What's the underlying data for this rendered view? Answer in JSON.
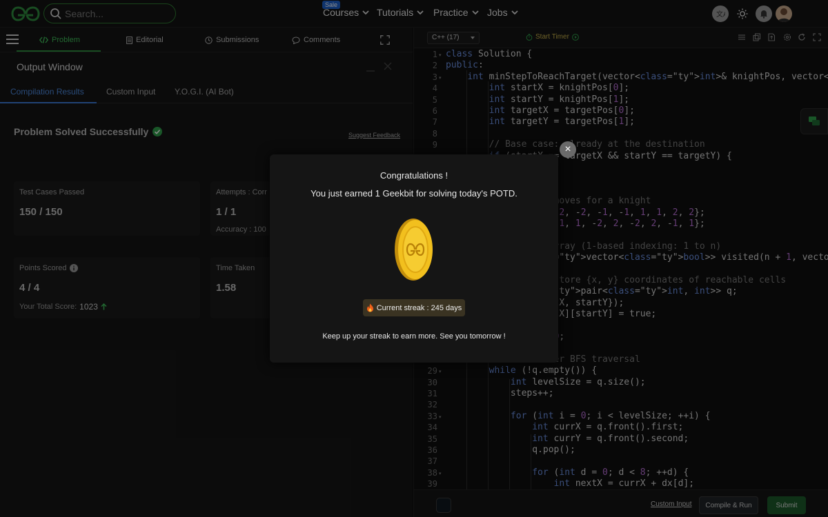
{
  "nav": {
    "search_placeholder": "Search...",
    "sale_badge": "Sale",
    "items": [
      {
        "label": "Courses"
      },
      {
        "label": "Tutorials"
      },
      {
        "label": "Practice"
      },
      {
        "label": "Jobs"
      }
    ]
  },
  "problem_tabs": [
    {
      "label": "Problem"
    },
    {
      "label": "Editorial"
    },
    {
      "label": "Submissions"
    },
    {
      "label": "Comments"
    }
  ],
  "output": {
    "title": "Output Window",
    "tabs": [
      {
        "label": "Compilation Results"
      },
      {
        "label": "Custom Input"
      },
      {
        "label": "Y.O.G.I. (AI Bot)"
      }
    ],
    "status": "Problem Solved Successfully",
    "feedback": "Suggest Feedback",
    "cards": {
      "test_cases": {
        "label": "Test Cases Passed",
        "value": "150 / 150"
      },
      "attempts": {
        "label": "Attempts : Corr",
        "value": "1 / 1",
        "sub": "Accuracy : 100"
      },
      "points": {
        "label": "Points Scored",
        "value": "4 / 4",
        "sub_label": "Your Total Score:",
        "sub_value": "1023"
      },
      "time": {
        "label": "Time Taken",
        "value": "1.58"
      }
    }
  },
  "editor": {
    "language": "C++ (17)",
    "timer": "Start Timer",
    "custom_input": "Custom Input",
    "compile": "Compile & Run",
    "submit": "Submit",
    "lines": [
      {
        "n": "1",
        "fold": true,
        "code": "class Solution {"
      },
      {
        "n": "2",
        "code": "public:"
      },
      {
        "n": "3",
        "fold": true,
        "code": "    int minStepToReachTarget(vector<int>& knightPos, vector<int>& targe"
      },
      {
        "n": "4",
        "code": "        int startX = knightPos[0];"
      },
      {
        "n": "5",
        "code": "        int startY = knightPos[1];"
      },
      {
        "n": "6",
        "code": "        int targetX = targetPos[0];"
      },
      {
        "n": "7",
        "code": "        int targetY = targetPos[1];"
      },
      {
        "n": "8",
        "code": ""
      },
      {
        "n": "9",
        "code": "        // Base case: already at the destination"
      },
      {
        "n": "",
        "code": "        if (startX == targetX && startY == targetY) {"
      },
      {
        "n": "",
        "code": ""
      },
      {
        "n": "",
        "code": ""
      },
      {
        "n": "",
        "code": ""
      },
      {
        "n": "",
        "code": "        // L-shaped moves for a knight"
      },
      {
        "n": "",
        "code": "        int dx[] = {-2, -2, -1, -1, 1, 1, 2, 2};"
      },
      {
        "n": "",
        "code": "        int dy[] = {-1, 1, -2, 2, -2, 2, -1, 1};"
      },
      {
        "n": "",
        "code": ""
      },
      {
        "n": "",
        "code": "        // Visited array (1-based indexing: 1 to n)"
      },
      {
        "n": "",
        "code": "        vector<vector<bool>> visited(n + 1, vector<bool>(n + 1, false));"
      },
      {
        "n": "",
        "code": ""
      },
      {
        "n": "",
        "code": "        // Queue to store {x, y} coordinates of reachable cells"
      },
      {
        "n": "",
        "code": "        queue<pair<int, int>> q;"
      },
      {
        "n": "",
        "code": "        q.push({startX, startY});"
      },
      {
        "n": "",
        "code": "        visited[startX][startY] = true;"
      },
      {
        "n": "",
        "code": ""
      },
      {
        "n": "",
        "code": "        int steps = 0;"
      },
      {
        "n": "",
        "code": ""
      },
      {
        "n": "",
        "code": "        // Level-order BFS traversal"
      },
      {
        "n": "29",
        "fold": true,
        "code": "        while (!q.empty()) {"
      },
      {
        "n": "30",
        "code": "            int levelSize = q.size();"
      },
      {
        "n": "31",
        "code": "            steps++;"
      },
      {
        "n": "32",
        "code": ""
      },
      {
        "n": "33",
        "fold": true,
        "code": "            for (int i = 0; i < levelSize; ++i) {"
      },
      {
        "n": "34",
        "code": "                int currX = q.front().first;"
      },
      {
        "n": "35",
        "code": "                int currY = q.front().second;"
      },
      {
        "n": "36",
        "code": "                q.pop();"
      },
      {
        "n": "37",
        "code": ""
      },
      {
        "n": "38",
        "fold": true,
        "code": "                for (int d = 0; d < 8; ++d) {"
      },
      {
        "n": "39",
        "code": "                    int nextX = currX + dx[d];"
      }
    ]
  },
  "modal": {
    "title": "Congratulations !",
    "message": "You just earned 1 Geekbit for solving today's POTD.",
    "streak": "Current streak : 245 days",
    "footer": "Keep up your streak to earn more. See you tomorrow !",
    "close": "×"
  },
  "colors": {
    "brand_green": "#2f8d3f",
    "accent_blue": "#3d7ad8",
    "coin_gold": "#f2c01e"
  }
}
